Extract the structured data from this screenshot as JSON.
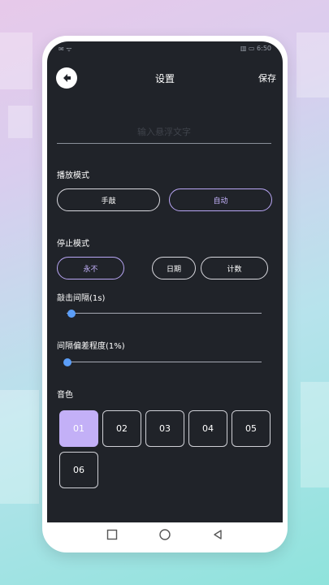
{
  "status_bar": {
    "left": "✉ ᯤ",
    "right": "▥ ▭ 6:50"
  },
  "header": {
    "title": "设置",
    "save_label": "保存"
  },
  "text_input": {
    "placeholder": "输入悬浮文字",
    "value": ""
  },
  "play_mode": {
    "label": "播放模式",
    "options": [
      "手敲",
      "自动"
    ],
    "selected": "自动"
  },
  "stop_mode": {
    "label": "停止模式",
    "options": [
      "永不",
      "日期",
      "计数"
    ],
    "selected": "永不"
  },
  "tap_interval": {
    "label": "敲击间隔(1s)",
    "value_fraction": 0.0
  },
  "deviation": {
    "label": "间隔偏差程度(1%)",
    "value_fraction": 0.0
  },
  "tone": {
    "label": "音色",
    "options": [
      "01",
      "02",
      "03",
      "04",
      "05",
      "06"
    ],
    "selected": "01"
  },
  "colors": {
    "screen_bg": "#202329",
    "accent": "#c3b0f7",
    "slider_thumb": "#5b9ef8"
  },
  "icons": {
    "back": "back-arrow-icon",
    "home": "home-square-icon",
    "circle": "home-circle-icon",
    "triangle": "back-triangle-icon"
  }
}
